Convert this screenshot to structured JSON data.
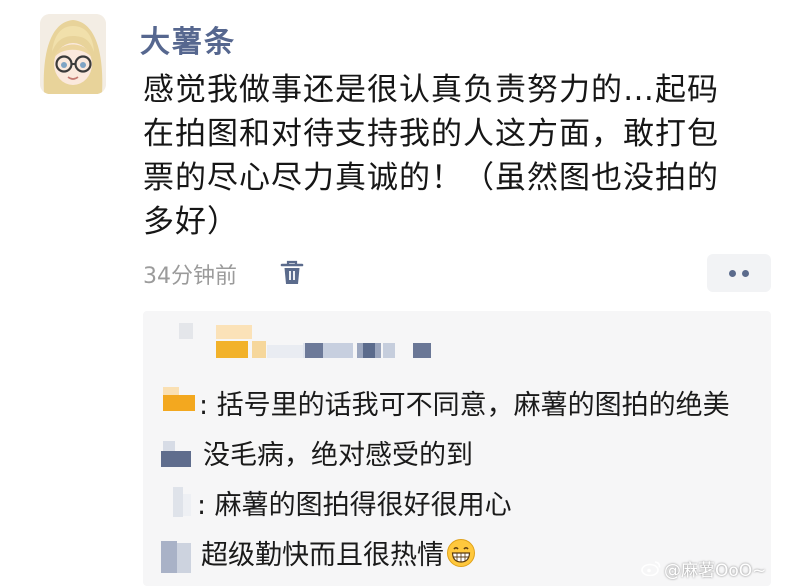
{
  "post": {
    "username": "大薯条",
    "text_lines": [
      "感觉我做事还是很认真负责努力的…起码",
      "在拍图和对待支持我的人这方面，敢打包",
      "票的尽心尽力真诚的！（虽然图也没拍的",
      "多好）"
    ],
    "timestamp": "34分钟前",
    "icons": {
      "delete": "trash-icon",
      "more": "more-dots-icon"
    }
  },
  "comments": {
    "lines": [
      ": 括号里的话我可不同意，麻薯的图拍的绝美",
      "没毛病，绝对感受的到",
      ": 麻薯的图拍得很好很用心",
      "超级勤快而且很热情"
    ],
    "emoji": "grin-emoji"
  },
  "watermark": {
    "text": "@麻薯OoO~",
    "icon": "weibo-icon"
  },
  "colors": {
    "username": "#56678f",
    "timestamp": "#9b9b9b",
    "comment_bg": "#f6f6f7",
    "more_dots": "#5b6b8c"
  }
}
